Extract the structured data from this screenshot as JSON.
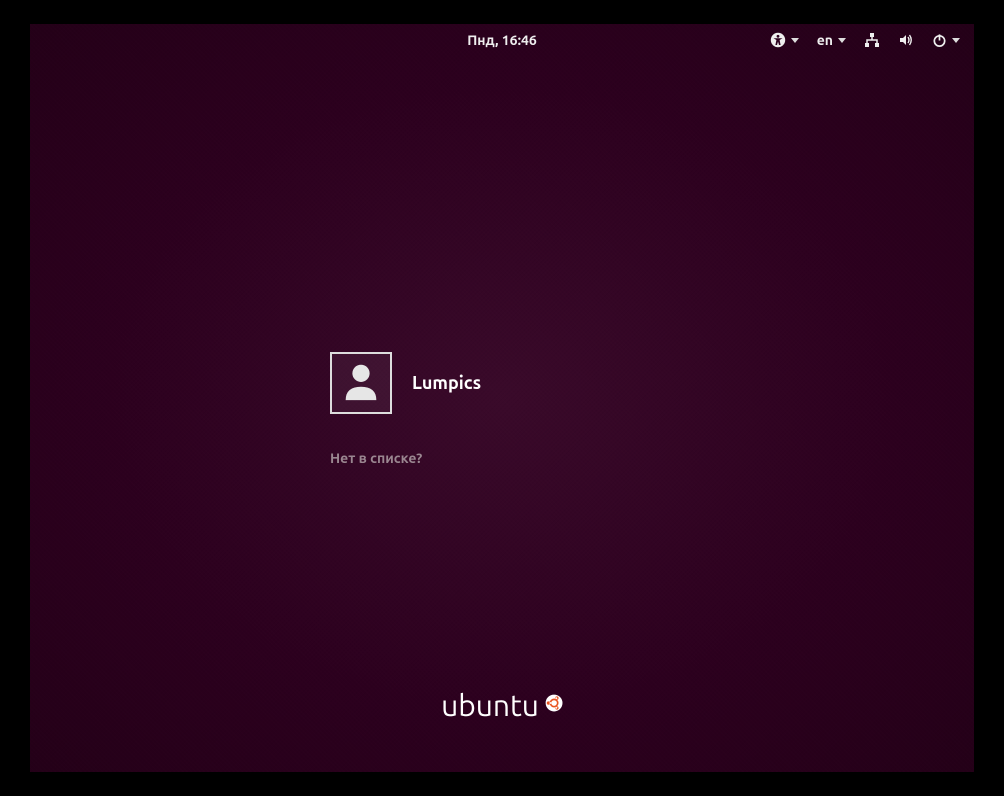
{
  "topbar": {
    "clock": "Пнд, 16:46",
    "language": "en"
  },
  "users": [
    {
      "name": "Lumpics"
    }
  ],
  "not_listed_label": "Нет в списке?",
  "footer": {
    "brand": "ubuntu"
  },
  "colors": {
    "background": "#2c001e",
    "accent": "#e95420"
  }
}
